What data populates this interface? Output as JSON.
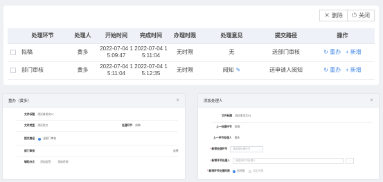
{
  "toolbar": {
    "delete": {
      "icon": "close-icon",
      "label": "删除"
    },
    "close": {
      "icon": "power-icon",
      "label": "关闭"
    }
  },
  "table": {
    "headers": [
      "处理环节",
      "处理人",
      "开始时间",
      "完成时间",
      "办理时限",
      "处理意见",
      "提交路径",
      "操作"
    ],
    "rows": [
      {
        "step": "拟稿",
        "handler": "黄多",
        "start": "2022-07-04 1\n5:09:47",
        "end": "2022-07-04 1\n5:11:04",
        "limit": "无时限",
        "opinion": "无",
        "path": "送部门审核",
        "redo": "重办",
        "add": "新增"
      },
      {
        "step": "部门审核",
        "handler": "黄多",
        "start": "2022-07-04 1\n5:11:04",
        "end": "2022-07-04 1\n5:12:35",
        "limit": "无时限",
        "opinion": "阅知",
        "path": "送申请人阅知",
        "redo": "重办",
        "add": "新增"
      }
    ]
  },
  "redo_dialog": {
    "title": "重办（黄多）",
    "doc_title_label": "文件标题",
    "doc_title_value": "测试收发文04",
    "doc_type_label": "文件类型",
    "doc_type_value": "测试发文",
    "step_label": "处理环节",
    "step_value": "拟稿",
    "path_label": "提交路径",
    "path_value": "送部门审核",
    "dept_label": "部门审核",
    "dept_right": "选择",
    "aux_label": "辅助办文",
    "aux_opt1": "添加会签",
    "aux_opt2": "添加传阅"
  },
  "add_dialog": {
    "title": "添加处理人",
    "doc_title_label": "文件标题",
    "doc_title_value": "测试收发文04",
    "prev_step_label": "上一处理环节",
    "prev_step_value": "拟稿",
    "prev_handler_label": "上一环节处理人",
    "prev_handler_value": "黄多",
    "new_step_label": "新增处理环节",
    "new_step_placeholder": "请选择处理环节",
    "new_handler_label": "新增环节处理人",
    "new_handler_placeholder": "请选择环节处理人",
    "new_proc_label": "新增环节处理时限",
    "new_proc_opt1": "无时限",
    "new_proc_opt2": "设定时限"
  }
}
